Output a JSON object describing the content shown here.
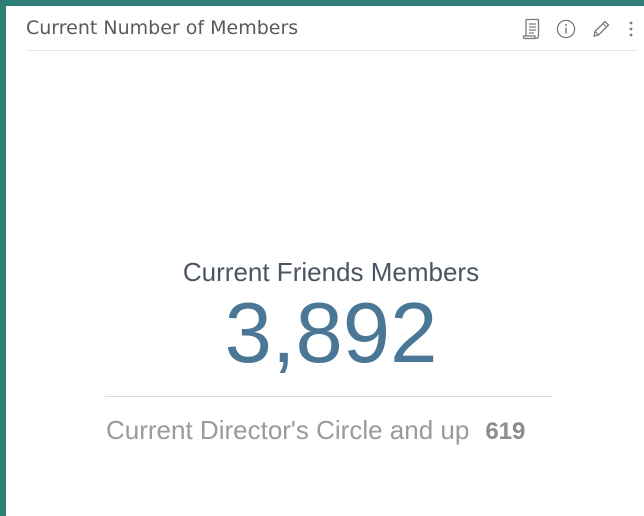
{
  "widget": {
    "title": "Current Number of Members",
    "icons": [
      "report-icon",
      "info-icon",
      "edit-icon",
      "more-vertical-icon"
    ]
  },
  "kpi": {
    "primary_label": "Current Friends Members",
    "primary_value": "3,892",
    "secondary_label": "Current Director's Circle and up",
    "secondary_value": "619"
  },
  "colors": {
    "frame": "#2f7f79",
    "value": "#4a7796",
    "label": "#4b5562",
    "secondary": "#9a9a9a"
  }
}
